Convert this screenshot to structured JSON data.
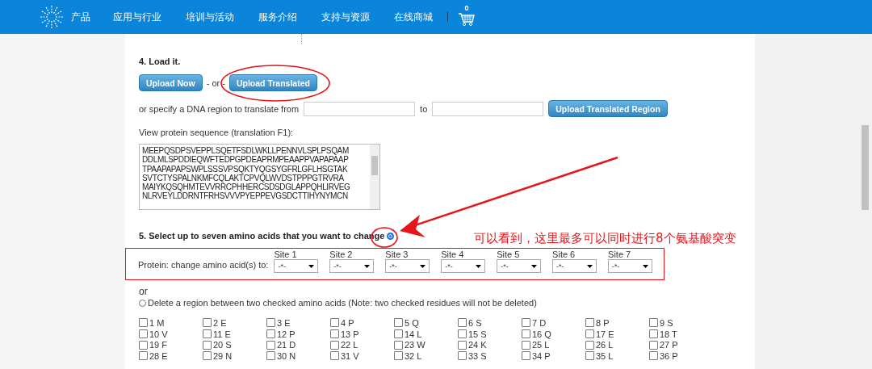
{
  "header": {
    "nav": [
      "产品",
      "应用与行业",
      "培训与活动",
      "服务介绍",
      "支持与资源",
      "在线商城"
    ],
    "cart_count": "0"
  },
  "step4": {
    "title": "4. Load it.",
    "upload_now": "Upload Now",
    "separator": "- or -",
    "upload_translated": "Upload Translated",
    "region_label": "or specify a DNA region to translate from",
    "to_label": "to",
    "upload_region": "Upload Translated Region"
  },
  "protein": {
    "label": "View protein sequence (translation F1):",
    "lines": [
      "MEEPQSDPSVEPPLSQETFSDLWKLLPENNVLSPLPSQAM",
      "DDLMLSPDDIEQWFTEDPGPDEAPRMPEAAPPVAPAPAAP",
      "TPAAPAPAPSWPLSSSVPSQKTYQGSYGFRLGFLHSGTAK",
      "SVTCTYSPALNKMFCQLAKTCPVQLWVDSTPPPGTRVRA",
      "MAIYKQSQHMTEVVRRCPHHERCSDSDGLAPPQHLIRVEG",
      "NLRVEYLDDRNTFRHSVVVPYEPPEVGSDCTTIHYNYMCN"
    ]
  },
  "step5": {
    "title": "5. Select up to seven amino acids that you want to change",
    "selected": true,
    "protein_label": "Protein: change amino acid(s) to:",
    "sites": [
      {
        "label": "Site 1",
        "value": "-*-"
      },
      {
        "label": "Site 2",
        "value": "-*-"
      },
      {
        "label": "Site 3",
        "value": "-*-"
      },
      {
        "label": "Site 4",
        "value": "-*-"
      },
      {
        "label": "Site 5",
        "value": "-*-"
      },
      {
        "label": "Site 6",
        "value": "-*-"
      },
      {
        "label": "Site 7",
        "value": "-*-"
      }
    ]
  },
  "or_label": "or",
  "delete_option": {
    "label": "Delete a region between two checked amino acids (Note: two checked residues will not be deleted)",
    "selected": false
  },
  "residues": [
    {
      "label": "1 M",
      "checked": false
    },
    {
      "label": "2 E",
      "checked": false
    },
    {
      "label": "3 E",
      "checked": false
    },
    {
      "label": "4 P",
      "checked": false
    },
    {
      "label": "5 Q",
      "checked": false
    },
    {
      "label": "6 S",
      "checked": false
    },
    {
      "label": "7 D",
      "checked": false
    },
    {
      "label": "8 P",
      "checked": false
    },
    {
      "label": "9 S",
      "checked": false
    },
    {
      "label": "10 V",
      "checked": false
    },
    {
      "label": "11 E",
      "checked": false
    },
    {
      "label": "12 P",
      "checked": false
    },
    {
      "label": "13 P",
      "checked": false
    },
    {
      "label": "14 L",
      "checked": false
    },
    {
      "label": "15 S",
      "checked": false
    },
    {
      "label": "16 Q",
      "checked": false
    },
    {
      "label": "17 E",
      "checked": false
    },
    {
      "label": "18 T",
      "checked": false
    },
    {
      "label": "19 F",
      "checked": false
    },
    {
      "label": "20 S",
      "checked": false
    },
    {
      "label": "21 D",
      "checked": false
    },
    {
      "label": "22 L",
      "checked": false
    },
    {
      "label": "23 W",
      "checked": false
    },
    {
      "label": "24 K",
      "checked": false
    },
    {
      "label": "25 L",
      "checked": false
    },
    {
      "label": "26 L",
      "checked": false
    },
    {
      "label": "27 P",
      "checked": false
    },
    {
      "label": "28 E",
      "checked": false
    },
    {
      "label": "29 N",
      "checked": false
    },
    {
      "label": "30 N",
      "checked": false
    },
    {
      "label": "31 V",
      "checked": false
    },
    {
      "label": "32 L",
      "checked": false
    },
    {
      "label": "33 S",
      "checked": false
    },
    {
      "label": "34 P",
      "checked": false
    },
    {
      "label": "35 L",
      "checked": false
    },
    {
      "label": "36 P",
      "checked": false
    }
  ],
  "annotation": {
    "text": "可以看到，这里最多可以同时进行8个氨基酸突变"
  }
}
